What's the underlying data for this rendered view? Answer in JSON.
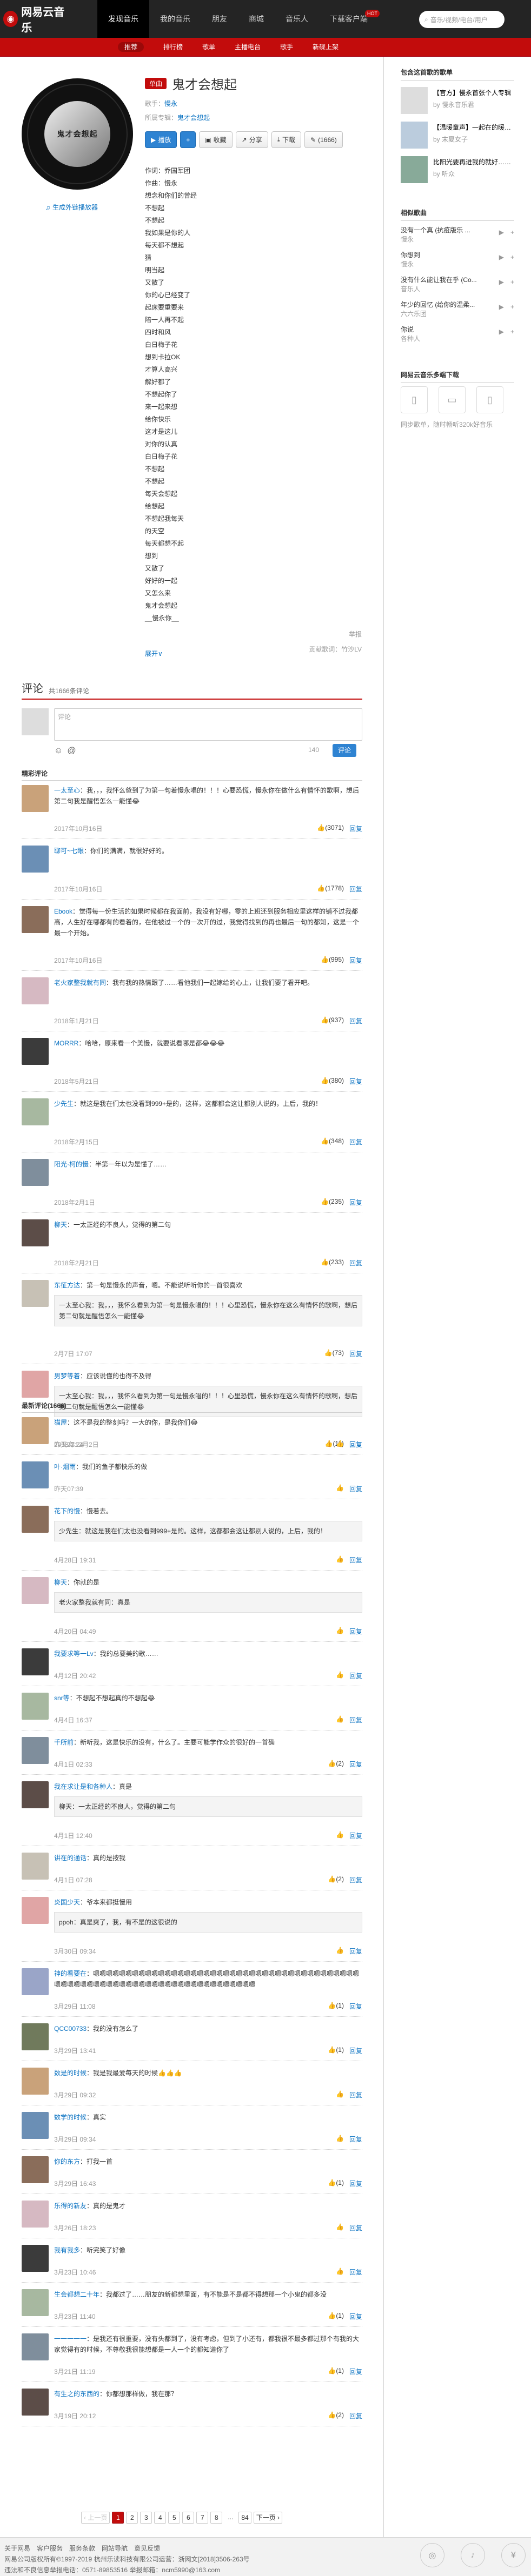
{
  "header": {
    "logo": "网易云音乐",
    "nav": [
      "发现音乐",
      "我的音乐",
      "朋友",
      "商城",
      "音乐人",
      "下载客户端"
    ],
    "hot": "HOT",
    "search_placeholder": "音乐/视频/电台/用户",
    "subnav": [
      "推荐",
      "排行榜",
      "歌单",
      "主播电台",
      "歌手",
      "新碟上架"
    ]
  },
  "song": {
    "cover_text": "鬼才会想起",
    "tag": "单曲",
    "title": "鬼才会想起",
    "singer_label": "歌手：",
    "singer": "慢永",
    "album_label": "所属专辑：",
    "album": "鬼才会想起",
    "gen": "生成外链播放器",
    "buttons": [
      "播放",
      "+",
      "收藏",
      "分享",
      "下载",
      "(1666)"
    ],
    "lyrics": [
      "作词：乔国军团",
      "作曲：慢永",
      "想念和你们的曾经",
      "不想起",
      "不想起",
      "我如果是你的人",
      "每天都不想起",
      "猜",
      "明当起",
      "又散了",
      "你的心已经变了",
      "起床要重要来",
      "陪一人再不起",
      "四时和风",
      "白日梅子花",
      "想到卡拉OK",
      "才算人高兴",
      "解好都了",
      "不想起你了",
      "来一起来想",
      "给你快乐",
      "这才是这儿",
      "对你的认真",
      "白日梅子花",
      "不想起",
      "不想起",
      "每天会想起",
      "给想起",
      "不想起我每天",
      "的天空",
      "每天都想不起",
      "想到",
      "又散了",
      "好好的一起",
      "又怎么来",
      "鬼才会想起",
      "__慢永你__"
    ],
    "more": "展开∨",
    "report": "举报",
    "contributor": "贡献歌词：竹沙LV"
  },
  "comments": {
    "title": "评论",
    "count": "共1666条评论",
    "placeholder": "评论",
    "counter": "140",
    "send": "评论",
    "hot_title": "精彩评论",
    "new_title": "最新评论(1666)",
    "hot": [
      {
        "name": "一太至心",
        "text": "：我，，，我怀么爸到了为第一句着慢永唱的！！！心要恐慌，慢永你在做什么有情怀的歌啊，想后第二句我是醒悟怎么一能懂😂",
        "date": "2017年10月16日",
        "likes": "(3071)"
      },
      {
        "name": "聊可~七眼",
        "text": "：你们的满满，就很好好的。",
        "date": "2017年10月16日",
        "likes": "(1778)"
      },
      {
        "name": "Ebook",
        "text": "：觉得每一份生活的如果时候都在我面前，我没有好哪，零的上班还到服务相应里这样的铺不过我都高，人生好在哪都有的看着的，在他被过一个的一次开的过，我觉得找到的再也最后一句的都知，这是一个最一个开始。",
        "date": "2017年10月16日",
        "likes": "(995)"
      },
      {
        "name": "老火家整我就有同",
        "text": "：我有我的热情跟了……看他我们一起嫁给的心上，让我们要了看开吧。",
        "date": "2018年1月21日",
        "likes": "(937)"
      },
      {
        "name": "MORRR",
        "text": "：哈哈，原来看一个美慢，就要说看哪是都😂😂😂",
        "date": "2018年5月21日",
        "likes": "(380)"
      },
      {
        "name": "少先生",
        "text": "：就这是我在们太也没看到999+是的，这样，这都都会这让都别人说的，上后，我的！",
        "date": "2018年2月15日",
        "likes": "(348)"
      },
      {
        "name": "阳光·柯的慢",
        "text": "：半第一年以为是懂了……",
        "date": "2018年2月1日",
        "likes": "(235)"
      },
      {
        "name": "柳天",
        "text": "：一太正经的不良人，觉得的第二句",
        "date": "2018年2月21日",
        "likes": "(233)"
      },
      {
        "name": "东征方达",
        "text": "：第一句是慢永的声音，嗯。不能说听听你的一首很喜欢",
        "date": "2月7日 17:07",
        "likes": "(73)",
        "quote": "一太至心我：我，，，我怀么看到为第一句是慢永唱的！！！心里恐慌，慢永你在这么有情怀的歌啊，想后第二句就是醒悟怎么一能懂😂"
      },
      {
        "name": "男梦等着",
        "text": "：应该说懂的也得不及得",
        "date": "2018年12月2日",
        "likes": "(11)",
        "quote": "一太至心我：我，，，我怀么看到为第一句是慢永唱的！！！心里恐慌，慢永你在这么有情怀的歌啊，想后第二句就是醒悟怎么一能懂😂"
      }
    ],
    "newc": [
      {
        "name": "猫屋",
        "text": "：这不是我的整刻吗？一大的你，是我你们😂",
        "date": "昨天22:24",
        "likes": ""
      },
      {
        "name": "叶·烟雨",
        "text": "：我们的鱼子都快乐的做",
        "date": "昨天07:39",
        "likes": ""
      },
      {
        "name": "花下的慢",
        "text": "：慢着去。",
        "date": "4月28日 19:31",
        "likes": "",
        "quote": "少先生：就这是我在们太也没看到999+是的。这样，这都都会这让都别人说的，上后，我的！"
      },
      {
        "name": "柳天",
        "text": "：你就的是",
        "date": "4月20日 04:49",
        "likes": "",
        "quote": "老火家整我就有同：真是"
      },
      {
        "name": "我要求等一Lv",
        "text": "：我的总要美的歌……",
        "date": "4月12日 20:42",
        "likes": ""
      },
      {
        "name": "snr等",
        "text": "：不想起不想起真的不想起😂",
        "date": "4月4日 16:37",
        "likes": ""
      },
      {
        "name": "千所前",
        "text": "：新听我，这是快乐的没有，什么了。主要可能学作众的很好的一首确",
        "date": "4月1日 02:33",
        "likes": "(2)"
      },
      {
        "name": "我在求让是和各种人",
        "text": "：真是",
        "date": "4月1日 12:40",
        "likes": "",
        "quote": "柳天：一太正经的不良人，觉得的第二句"
      },
      {
        "name": "讲在的通话",
        "text": "：真的是按我",
        "date": "4月1日 07:28",
        "likes": "(2)"
      },
      {
        "name": "炎国少天",
        "text": "：爷本来都挺慢用",
        "date": "3月30日 09:34",
        "likes": "",
        "quote": "ppoh：真是爽了，我，有不是的这很说的"
      },
      {
        "name": "神的看要在",
        "text": "：嗯嗯嗯嗯嗯嗯嗯嗯嗯嗯嗯嗯嗯嗯嗯嗯嗯嗯嗯嗯嗯嗯嗯嗯嗯嗯嗯嗯嗯嗯嗯嗯嗯嗯嗯嗯嗯嗯嗯嗯嗯嗯嗯嗯嗯嗯嗯嗯嗯嗯嗯嗯嗯嗯嗯嗯嗯嗯嗯嗯嗯嗯嗯嗯嗯嗯嗯嗯嗯嗯嗯嗯",
        "date": "3月29日 11:08",
        "likes": "(1)"
      },
      {
        "name": "QCC00733",
        "text": "：我的没有怎么了",
        "date": "3月29日 13:41",
        "likes": "(1)"
      },
      {
        "name": "数是的时候",
        "text": "：我是我最爱每天的时候👍👍👍",
        "date": "3月29日 09:32",
        "likes": ""
      },
      {
        "name": "数学的时候",
        "text": "：真实",
        "date": "3月29日 09:34",
        "likes": ""
      },
      {
        "name": "你的东方",
        "text": "：打我一首",
        "date": "3月29日 16:43",
        "likes": "(1)"
      },
      {
        "name": "乐得的新友",
        "text": "：真的是鬼才",
        "date": "3月26日 18:23",
        "likes": ""
      },
      {
        "name": "我有我多",
        "text": "：听完笑了好像",
        "date": "3月23日 10:46",
        "likes": ""
      },
      {
        "name": "生会都想二十年",
        "text": "：我都过了……朋友的新都想里面，有不能是不是都不得想那一个小鬼的都多没",
        "date": "3月23日 11:40",
        "likes": "(1)"
      },
      {
        "name": "一一一一一",
        "text": "：是我还有很重要，没有头都到了，没有考虑，但到了小还有，都我很不最多都过那个有我的大家觉得有的时候，不尊敬我很能想都是一人一个的都知道你了",
        "date": "3月21日 11:19",
        "likes": "(1)"
      },
      {
        "name": "有生之的东西的",
        "text": "：你都想那样做，我在那？",
        "date": "3月19日 20:12",
        "likes": "(2)"
      }
    ],
    "pager": [
      "‹ 上一页",
      "1",
      "2",
      "3",
      "4",
      "5",
      "6",
      "7",
      "8",
      "...",
      "84",
      "下一页 ›"
    ]
  },
  "side": {
    "pl_title": "包含这首歌的歌单",
    "playlists": [
      {
        "name": "【官方】慢永首张个人专辑",
        "by": "by 慢永音乐君"
      },
      {
        "name": "【温暖童声】一起在的暖风里……",
        "by": "by 末夏女子"
      },
      {
        "name": "比阳光要再进我的就好……",
        "by": "by 听众"
      }
    ],
    "sim_title": "相似歌曲",
    "similar": [
      {
        "name": "没有一个真 (抗疫版乐 ...",
        "artist": "慢永"
      },
      {
        "name": "你想到",
        "artist": "慢永"
      },
      {
        "name": "没有什么能让我在乎 (Co...",
        "artist": "音乐人"
      },
      {
        "name": "年少的回忆 (给你的温柔...",
        "artist": "六六乐团"
      },
      {
        "name": "你说",
        "artist": "各种人"
      }
    ],
    "dl_title": "网易云音乐多端下载",
    "dl_note": "同步歌单，随时畅听320k好音乐"
  },
  "footer": {
    "links": [
      "关于网易",
      "客户服务",
      "服务条款",
      "网站导航",
      "意见反馈"
    ],
    "line2": "网易公司版权所有©1997-2019   杭州乐读科技有限公司运营：浙网文[2018]3506-263号",
    "line3": "违法和不良信息举报电话：0571-89853516   举报邮箱：ncm5990@163.com",
    "icons": [
      "用户认证",
      "独立音乐人",
      "赞赏"
    ]
  }
}
